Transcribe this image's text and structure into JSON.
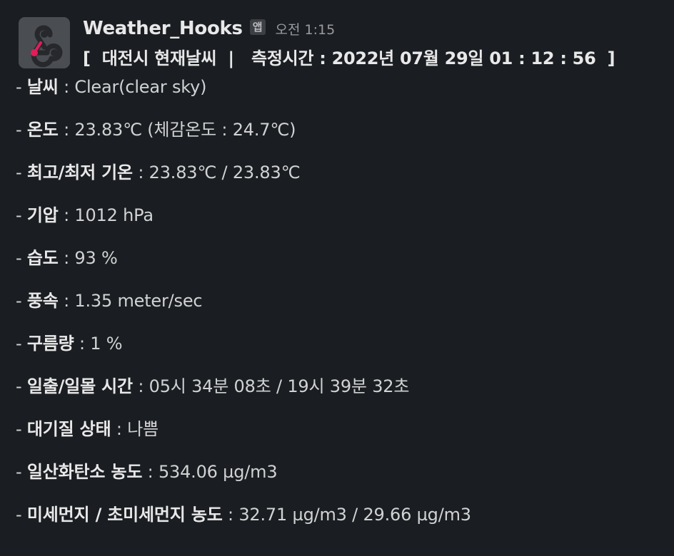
{
  "message": {
    "sender": "Weather_Hooks",
    "app_badge": "앱",
    "timestamp": "오전 1:15",
    "title": "[  대전시 현재날씨  |   측정시간 : 2022년 07월 29일 01 : 12 : 56  ]",
    "items": [
      {
        "label": "날씨",
        "value": "Clear(clear sky)"
      },
      {
        "label": "온도",
        "value": "23.83℃ (체감온도 : 24.7℃)"
      },
      {
        "label": "최고/최저 기온",
        "value": "23.83℃ / 23.83℃"
      },
      {
        "label": "기압",
        "value": "1012 hPa"
      },
      {
        "label": "습도",
        "value": "93 %"
      },
      {
        "label": "풍속",
        "value": "1.35 meter/sec"
      },
      {
        "label": "구름량",
        "value": "1 %"
      },
      {
        "label": "일출/일몰 시간",
        "value": "05시 34분 08초 / 19시 39분 32초"
      },
      {
        "label": "대기질 상태",
        "value": "나쁨"
      },
      {
        "label": "일산화탄소 농도",
        "value": "534.06 µg/m3"
      },
      {
        "label": "미세먼지 / 초미세먼지 농도",
        "value": "32.71 µg/m3 / 29.66 µg/m3"
      }
    ]
  },
  "icons": {
    "avatar": "webhook-icon"
  },
  "colors": {
    "background": "#1a1d21",
    "text": "#d1d2d3",
    "accent": "#e01e5a"
  }
}
